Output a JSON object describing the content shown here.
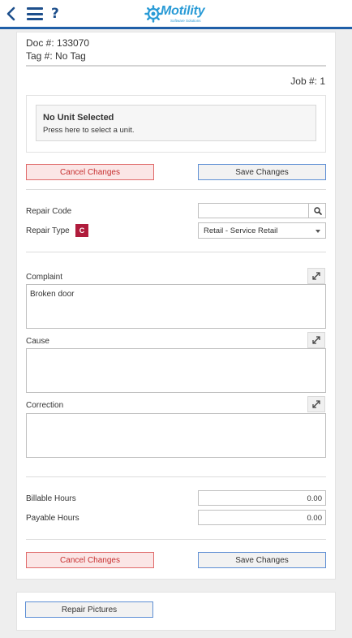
{
  "header": {
    "help_label": "?",
    "logo_text": "Motility",
    "logo_subtext": "Software Solutions",
    "brand_color": "#2a9bd6",
    "bar_color": "#1f5fa8"
  },
  "doc": {
    "doc_number": "Doc #: 133070",
    "tag_number": "Tag #: No Tag",
    "job_number": "Job #: 1"
  },
  "unit": {
    "title": "No Unit Selected",
    "subtitle": "Press here to select a unit."
  },
  "actions": {
    "cancel_label": "Cancel Changes",
    "save_label": "Save Changes"
  },
  "repair": {
    "code_label": "Repair Code",
    "code_value": "",
    "type_label": "Repair Type",
    "type_badge": "C",
    "type_value": "Retail - Service Retail"
  },
  "notes": {
    "complaint_label": "Complaint",
    "complaint_value": "Broken door",
    "cause_label": "Cause",
    "cause_value": "",
    "correction_label": "Correction",
    "correction_value": ""
  },
  "hours": {
    "billable_label": "Billable Hours",
    "billable_value": "0.00",
    "payable_label": "Payable Hours",
    "payable_value": "0.00"
  },
  "pictures": {
    "button_label": "Repair Pictures"
  }
}
